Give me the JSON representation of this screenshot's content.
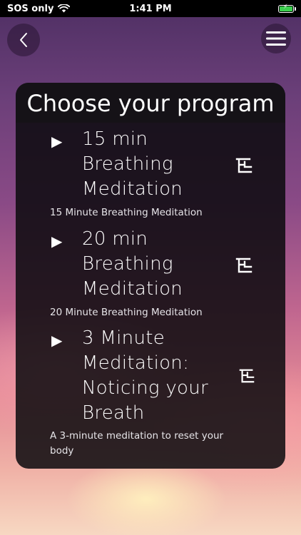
{
  "status_bar": {
    "carrier": "SOS only",
    "time": "1:41 PM"
  },
  "header": {
    "back_icon": "chevron-left-icon",
    "menu_icon": "hamburger-menu-icon"
  },
  "card": {
    "title": "Choose your program",
    "programs": [
      {
        "title_lines": [
          "15 min",
          "Breathing",
          "Meditation"
        ],
        "description": "15 Minute Breathing Meditation"
      },
      {
        "title_lines": [
          "20 min",
          "Breathing",
          "Meditation"
        ],
        "description": "20 Minute Breathing Meditation"
      },
      {
        "title_lines": [
          "3 Minute",
          "Meditation:",
          "Noticing your",
          "Breath"
        ],
        "description_lines": [
          "A 3-minute meditation to reset your",
          "body"
        ]
      }
    ]
  }
}
